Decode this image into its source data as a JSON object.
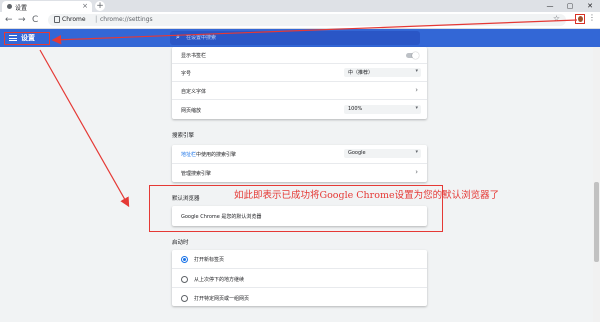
{
  "tab": {
    "title": "设置",
    "close": "×",
    "new_tab": "+"
  },
  "window_controls": {
    "minimize": "—",
    "maximize": "▢",
    "close": "✕"
  },
  "toolbar": {
    "back": "←",
    "forward": "→",
    "reload": "C",
    "site_label": "Chrome",
    "separator": "|",
    "url": "chrome://settings",
    "star": "☆",
    "menu": "⋮"
  },
  "header": {
    "title": "设置",
    "search_placeholder": "在设置中搜索"
  },
  "appearance": {
    "show_home_button": "显示书签栏",
    "font_size_label": "字号",
    "font_size_value": "中（推荐）",
    "custom_fonts_label": "自定义字体",
    "page_zoom_label": "网页缩放",
    "page_zoom_value": "100%"
  },
  "search_engine": {
    "section_title": "搜索引擎",
    "address_bar_link": "地址栏",
    "address_bar_label": "中使用的搜索引擎",
    "engine_value": "Google",
    "manage_label": "管理搜索引擎"
  },
  "default_browser": {
    "section_title": "默认浏览器",
    "status": "Google Chrome 是您的默认浏览器"
  },
  "on_startup": {
    "section_title": "启动时",
    "options": [
      "打开新标签页",
      "从上次停下的地方继续",
      "打开特定网页或一组网页"
    ]
  },
  "annotation": {
    "text": "如此即表示已成功将Google Chrome设置为您的默认浏览器了",
    "color": "#e53935"
  },
  "colors": {
    "header_blue": "#3367d6",
    "link_blue": "#1a73e8"
  }
}
